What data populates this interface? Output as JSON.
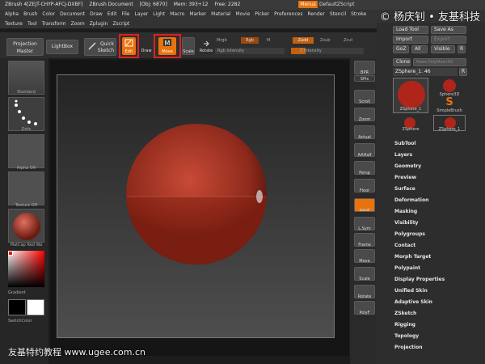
{
  "titlebar": {
    "app": "ZBrush 4[ZEJT-CHYP-AFCJ-DXBF]",
    "document": "ZBrush Document",
    "objs": "[Obj: 6870]",
    "mem": "Mem: 393+12",
    "free": "Free: 2282",
    "menus_label": "Menus",
    "script_label": "DefaultZScript"
  },
  "watermark_top": "© 杨庆钊 • 友基科技",
  "menu_row1": [
    "Alpha",
    "Brush",
    "Color",
    "Document",
    "Draw",
    "Edit",
    "File",
    "Layer",
    "Light",
    "Macro",
    "Marker",
    "Material",
    "Movie",
    "Picker",
    "Preferences",
    "Render",
    "Stencil",
    "Stroke"
  ],
  "menu_row2": [
    "Texture",
    "Tool",
    "Transform",
    "Zoom",
    "Zplugin",
    "Zscript"
  ],
  "toolbar": {
    "projection_master": "Projection\nMaster",
    "lightbox": "LightBox",
    "quick_sketch": "Quick\nSketch",
    "edit": "Edit",
    "draw": "Draw",
    "move": "Move",
    "scale": "Scale",
    "rotate": "Rotate",
    "mrgb": "Mrgb",
    "rgb": "Rgb",
    "m": "M",
    "zadd": "Zadd",
    "zsub": "Zsub",
    "zcut": "Zcut",
    "rgb_intensity": "Rgb Intensity",
    "z_intensity": "Z Intensity"
  },
  "left_shelf": {
    "brush_label": "Standard",
    "stroke_label": "Dots",
    "alpha_label": "Alpha Off",
    "texture_label": "Texture Off",
    "material_label": "MatCap Red Wa",
    "gradient_label": "Gradient",
    "switch_color_label": "SwitchColor"
  },
  "right_toolbar": [
    "BPR",
    "SPix",
    "Scroll",
    "Zoom",
    "Actual",
    "AAHalf",
    "Persp",
    "Floor",
    "Local",
    "L.Sym",
    "Frame",
    "Move",
    "Scale",
    "Rotate",
    "PolyF"
  ],
  "right_panel": {
    "load_tool": "Load Tool",
    "save_as": "Save As",
    "import": "Import",
    "export": "Export",
    "goz": "GoZ",
    "all": "All",
    "visible": "Visible",
    "r": "R",
    "clone": "Clone",
    "make_polymesh": "Make PolyMesh3D",
    "current_tool": "ZSphere_1. 46",
    "thumbs": [
      "ZSphere_1",
      "Sphere3D",
      "SimpleBrush",
      "ZSphere",
      "ZSphere_1"
    ],
    "sections": [
      "SubTool",
      "Layers",
      "Geometry",
      "Preview",
      "Surface",
      "Deformation",
      "Masking",
      "Visibility",
      "Polygroups",
      "Contact",
      "Morph Target",
      "Polypaint",
      "Display Properties",
      "Unified Skin",
      "Adaptive Skin",
      "ZSketch",
      "Rigging",
      "Topology",
      "Projection"
    ]
  },
  "watermark_bottom": "友基特约教程 www.ugee.com.cn",
  "colors": {
    "accent": "#e8720c",
    "highlight_box": "#e02020",
    "sphere": "#b03020"
  }
}
